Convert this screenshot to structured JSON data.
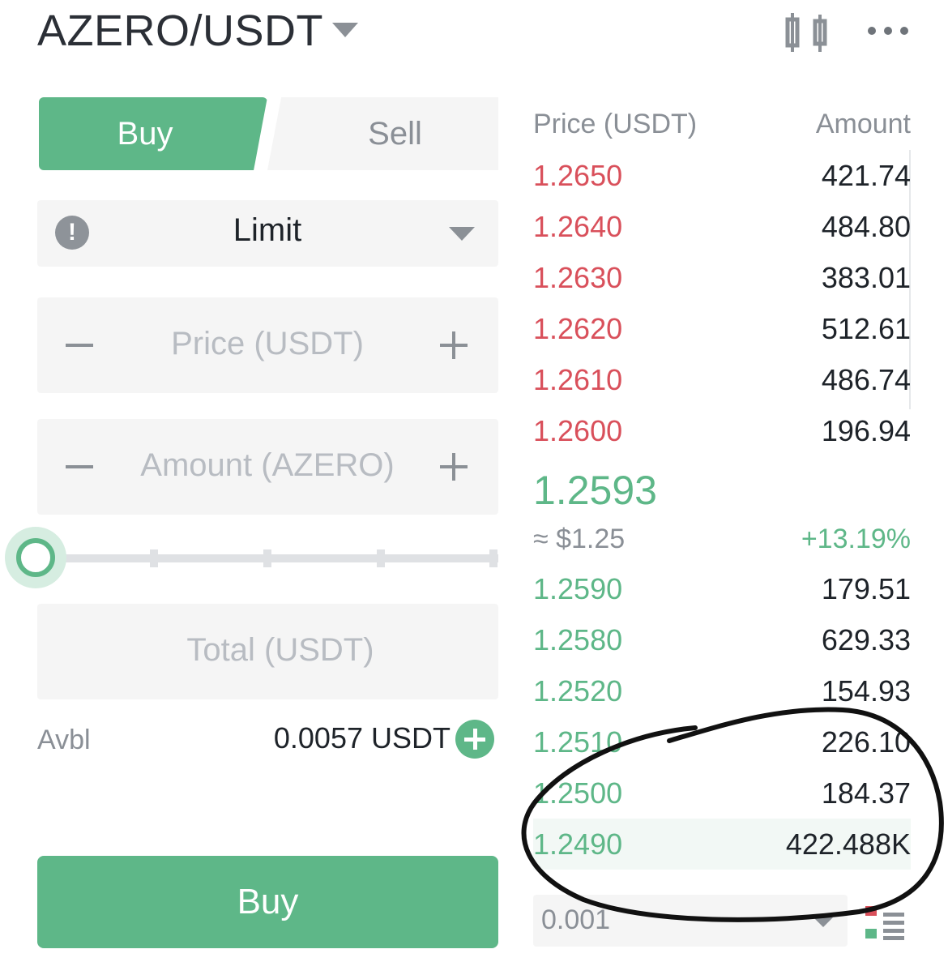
{
  "header": {
    "pair": "AZERO/USDT",
    "chart_icon": "candlestick-chart-icon",
    "more_icon": "more-horizontal-icon"
  },
  "tabs": {
    "buy": "Buy",
    "sell": "Sell"
  },
  "order_type": {
    "value": "Limit",
    "info_icon": "info-icon"
  },
  "inputs": {
    "price_placeholder": "Price (USDT)",
    "amount_placeholder": "Amount (AZERO)",
    "total_placeholder": "Total (USDT)"
  },
  "slider": {
    "value": 0
  },
  "available": {
    "label": "Avbl",
    "value": "0.0057 USDT"
  },
  "buy_button": "Buy",
  "order_book": {
    "price_header": "Price (USDT)",
    "amount_header": "Amount",
    "asks": [
      {
        "price": "1.2650",
        "amount": "421.74"
      },
      {
        "price": "1.2640",
        "amount": "484.80"
      },
      {
        "price": "1.2630",
        "amount": "383.01"
      },
      {
        "price": "1.2620",
        "amount": "512.61"
      },
      {
        "price": "1.2610",
        "amount": "486.74"
      },
      {
        "price": "1.2600",
        "amount": "196.94"
      }
    ],
    "last_price": "1.2593",
    "approx_usd": "≈ $1.25",
    "change": "+13.19%",
    "bids": [
      {
        "price": "1.2590",
        "amount": "179.51"
      },
      {
        "price": "1.2580",
        "amount": "629.33"
      },
      {
        "price": "1.2520",
        "amount": "154.93"
      },
      {
        "price": "1.2510",
        "amount": "226.10"
      },
      {
        "price": "1.2500",
        "amount": "184.37"
      },
      {
        "price": "1.2490",
        "amount": "422.488K"
      }
    ],
    "precision": "0.001",
    "view_icon": "orderbook-view-icon"
  },
  "colors": {
    "green": "#5eb788",
    "red": "#d9505b"
  }
}
